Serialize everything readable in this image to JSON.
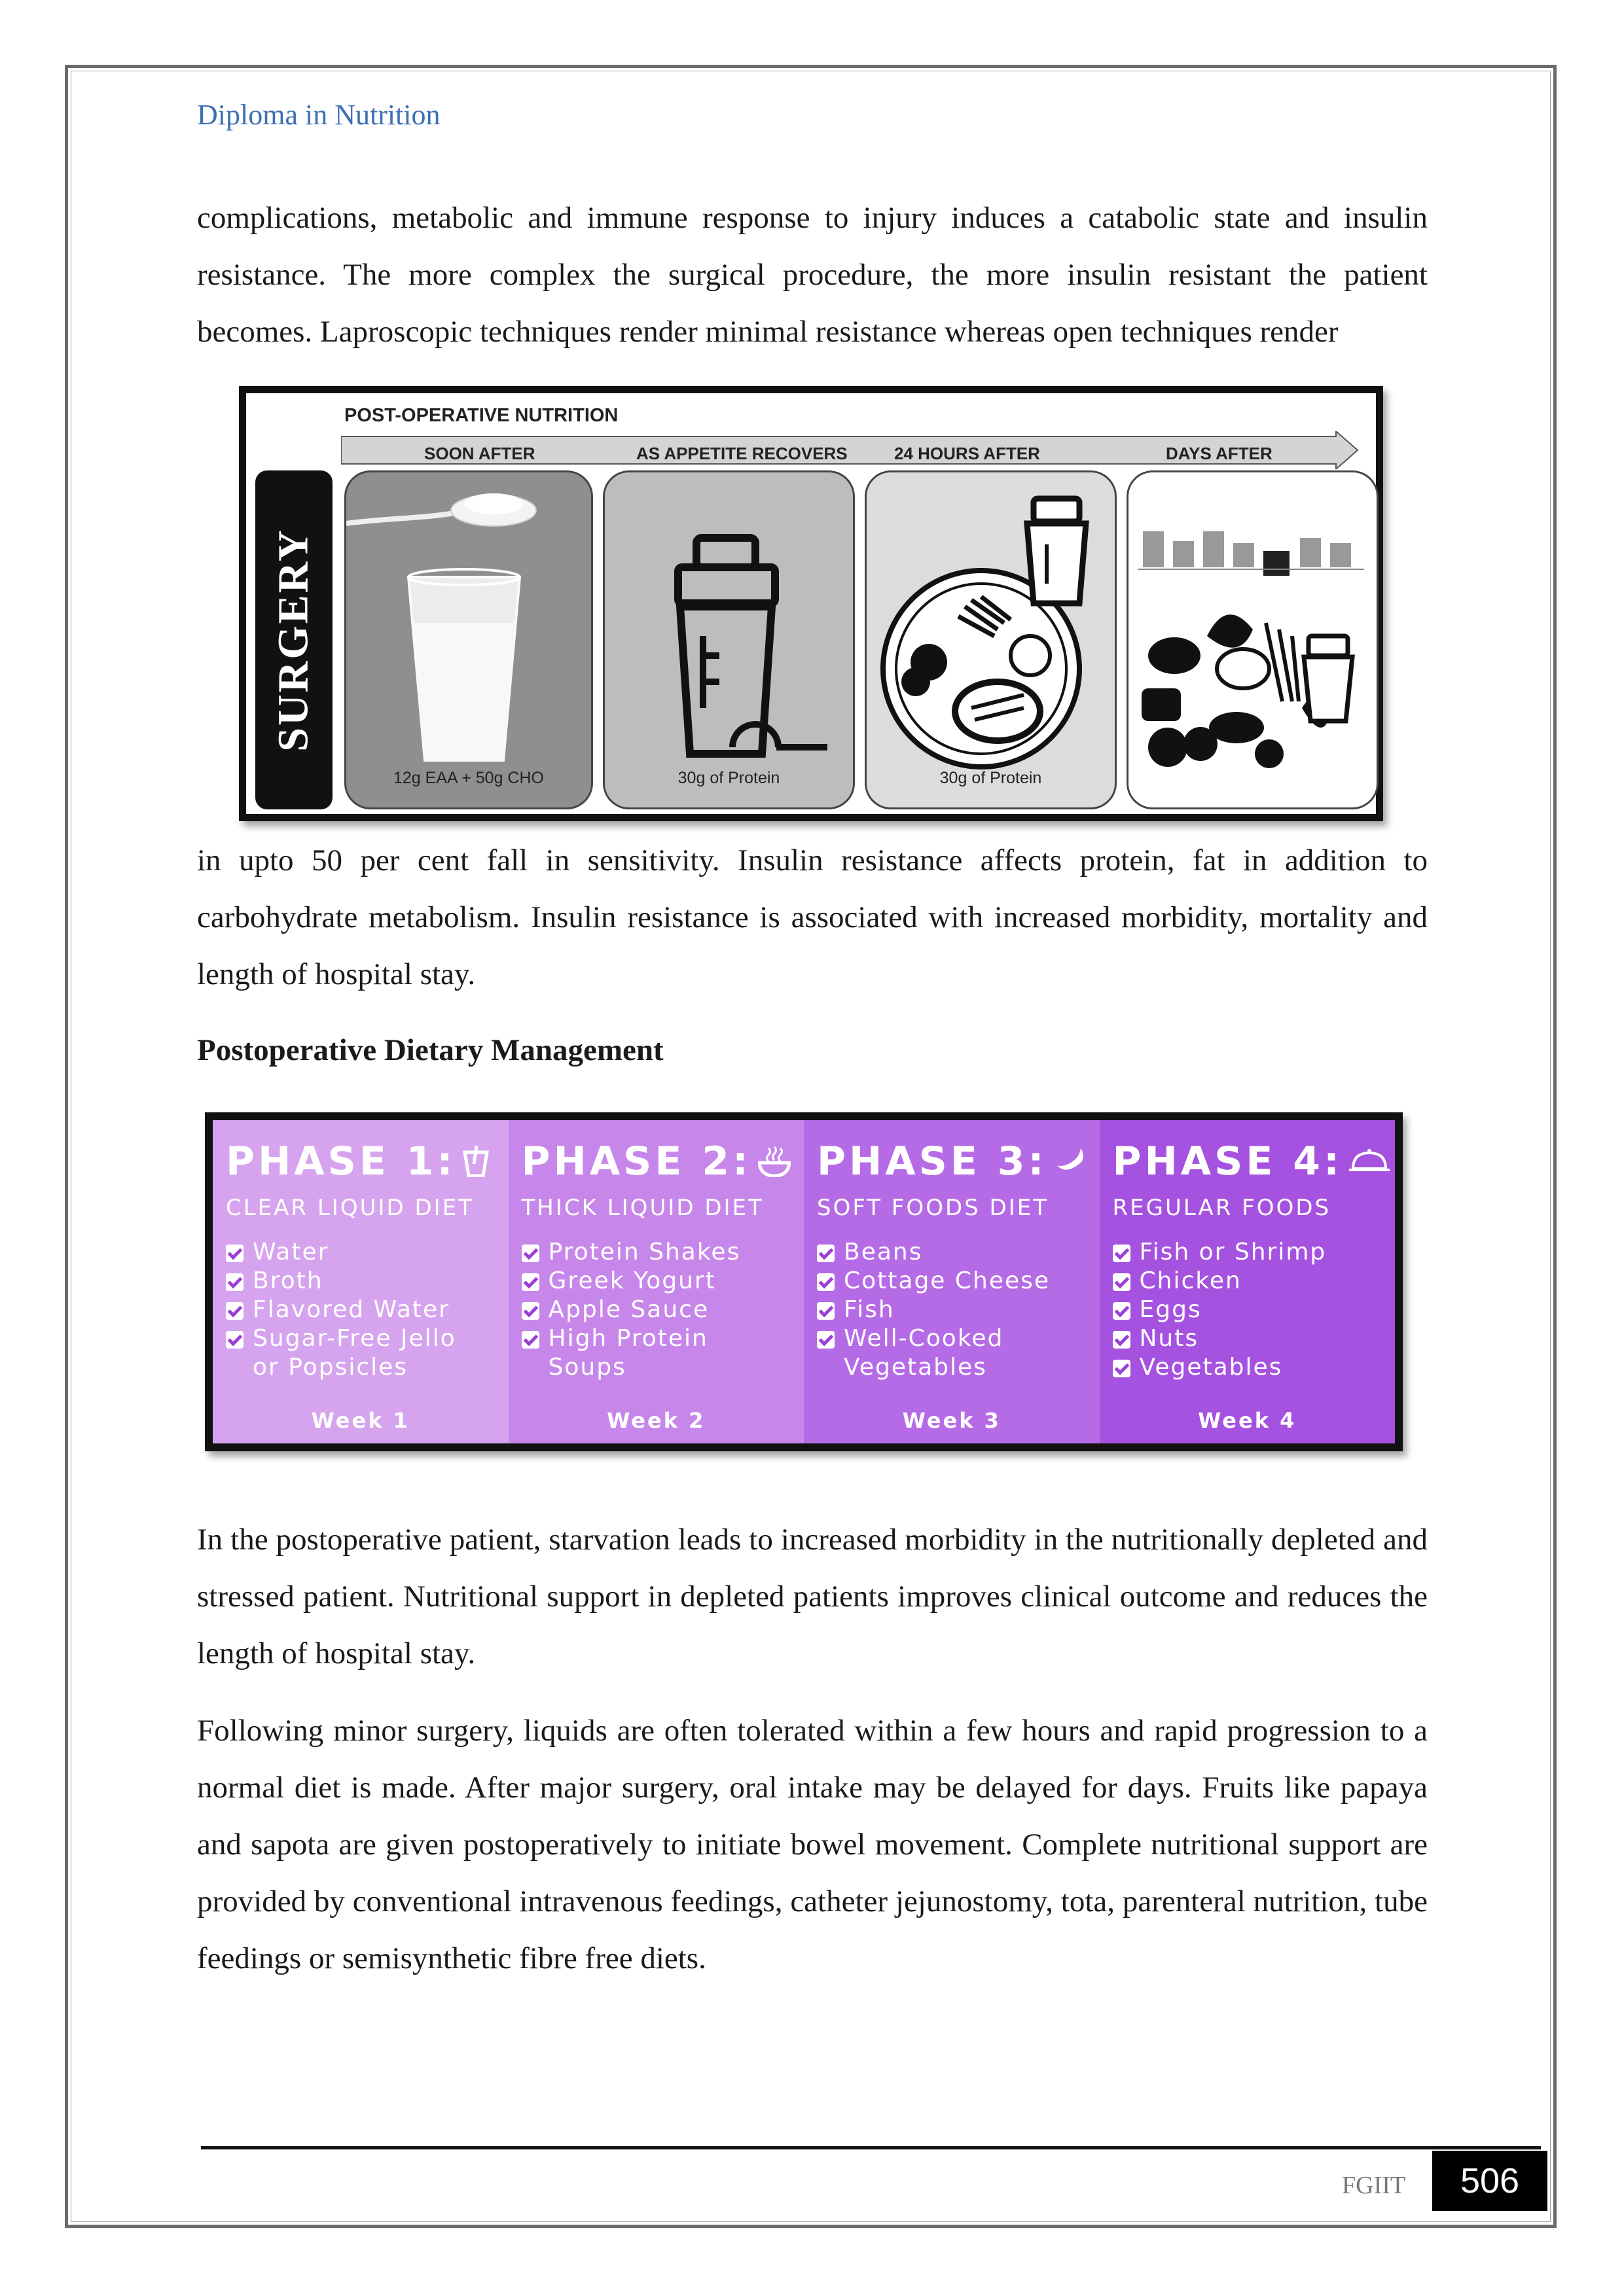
{
  "header": {
    "running_title": "Diploma in Nutrition"
  },
  "paragraphs": {
    "p1": "complications, metabolic and immune response to injury induces a catabolic state and insulin resistance. The more complex the surgical procedure, the more insulin resistant the patient becomes. Laproscopic techniques render minimal resistance whereas open techniques render",
    "p2": "in upto 50 per cent fall in sensitivity. Insulin resistance affects protein, fat in addition to carbohydrate metabolism. Insulin resistance is associated with increased morbidity, mortality and length of hospital stay.",
    "p3": "In the postoperative patient, starvation leads to increased morbidity in the nutritionally depleted and stressed patient. Nutritional support in depleted patients improves clinical outcome and reduces the length of hospital stay.",
    "p4": "Following minor surgery, liquids are often tolerated within a few hours and rapid progression to a normal diet is made. After major surgery, oral intake may be delayed for days. Fruits like papaya and sapota are given postoperatively to initiate bowel movement. Complete nutritional support are provided by conventional intravenous feedings, catheter jejunostomy, tota, parenteral nutrition, tube feedings or semisynthetic fibre free diets."
  },
  "section_heading": "Postoperative Dietary Management",
  "figure1": {
    "title": "POST-OPERATIVE NUTRITION",
    "side_label": "SURGERY",
    "stages": [
      {
        "label": "SOON AFTER",
        "caption": "12g EAA + 50g CHO",
        "bg": "#8f8f8f",
        "icon": "water-glass-spoon"
      },
      {
        "label": "AS APPETITE RECOVERS",
        "caption": "30g of Protein",
        "bg": "#bdbdbd",
        "icon": "protein-shaker"
      },
      {
        "label": "24 HOURS AFTER",
        "caption": "30g of Protein",
        "bg": "#dcdcdc",
        "icon": "meal-plate"
      },
      {
        "label": "DAYS AFTER",
        "caption": "",
        "bg": "#ffffff",
        "icon": "assorted-foods"
      }
    ]
  },
  "figure2": {
    "phases": [
      {
        "title": "PHASE 1:",
        "subtitle": "CLEAR LIQUID DIET",
        "items": [
          "Water",
          "Broth",
          "Flavored Water",
          "Sugar-Free Jello\nor Popsicles"
        ],
        "week": "Week 1",
        "bg": "#d6a4ee",
        "icon": "cup-icon"
      },
      {
        "title": "PHASE 2:",
        "subtitle": "THICK LIQUID DIET",
        "items": [
          "Protein Shakes",
          "Greek Yogurt",
          "Apple Sauce",
          "High Protein\nSoups"
        ],
        "week": "Week 2",
        "bg": "#c787ea",
        "icon": "bowl-icon"
      },
      {
        "title": "PHASE 3:",
        "subtitle": "SOFT FOODS DIET",
        "items": [
          "Beans",
          "Cottage Cheese",
          "Fish",
          "Well-Cooked\nVegetables"
        ],
        "week": "Week 3",
        "bg": "#b66be6",
        "icon": "banana-icon"
      },
      {
        "title": "PHASE 4:",
        "subtitle": "REGULAR FOODS",
        "items": [
          "Fish or Shrimp",
          "Chicken",
          "Eggs",
          "Nuts",
          "Vegetables"
        ],
        "week": "Week 4",
        "bg": "#a552e0",
        "icon": "cloche-icon"
      }
    ]
  },
  "footer": {
    "org": "FGIIT",
    "page_number": "506"
  }
}
